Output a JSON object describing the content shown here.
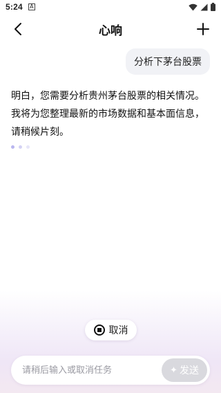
{
  "status_bar": {
    "time": "5:24",
    "notification_glyph": "A",
    "icons": [
      "wifi-icon",
      "signal-icon",
      "battery-icon"
    ]
  },
  "header": {
    "title": "心响",
    "back_icon": "chevron-left-icon",
    "plus_icon": "plus-icon"
  },
  "chat": {
    "user_message": "分析下茅台股票",
    "ai_lines": [
      "明白，您需要分析贵州茅台股票的相关情况。",
      "我将为您整理最新的市场数据和基本面信息，",
      "请稍候片刻。"
    ]
  },
  "loading_dots_colors": [
    "#b9b6ef",
    "#d4d2f4",
    "#e7e6f8"
  ],
  "cancel_button": {
    "label": "取消",
    "icon": "stop-icon"
  },
  "input": {
    "placeholder": "请稍后输入或取消任务",
    "value": ""
  },
  "send_button": {
    "label": "发送",
    "icon": "sparkle-icon"
  },
  "colors": {
    "bubble_bg": "#f1f2f6",
    "send_disabled": "#d9d9de",
    "gradient_bottom": "#efe6f6"
  }
}
